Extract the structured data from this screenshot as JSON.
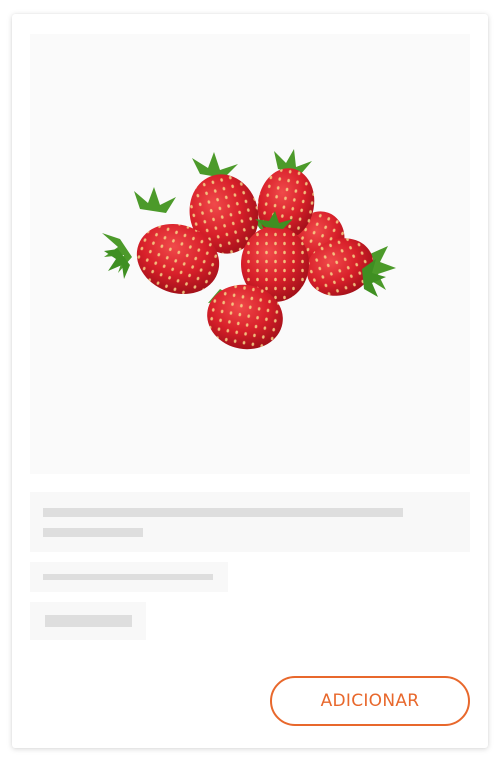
{
  "product": {
    "image_icon": "strawberries-image",
    "add_button_label": "ADICIONAR"
  },
  "colors": {
    "accent": "#e8682c",
    "skeleton_block": "#f8f8f8",
    "skeleton_line": "#dedede",
    "image_background": "#fafafa"
  }
}
